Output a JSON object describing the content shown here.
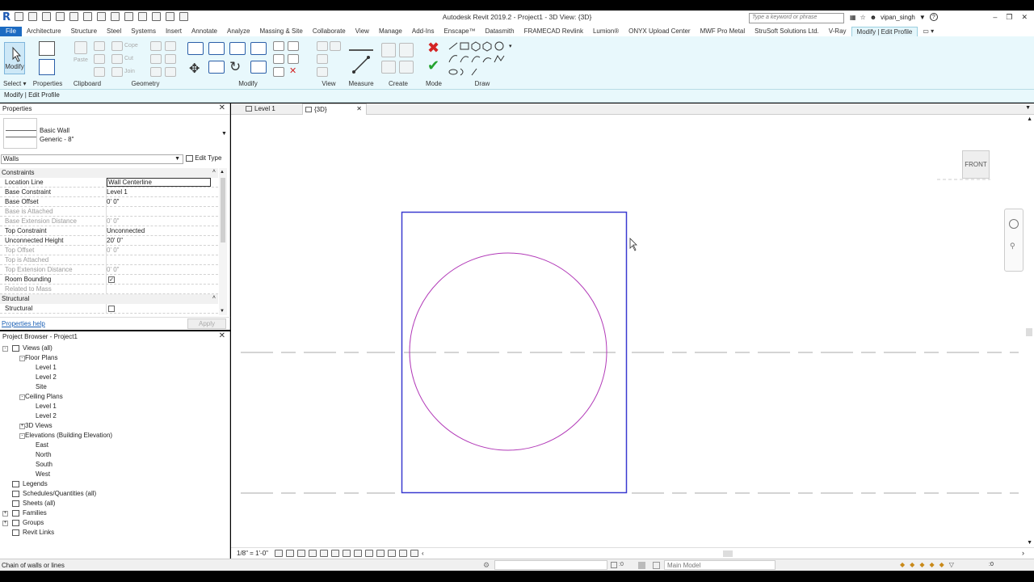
{
  "window": {
    "title": "Autodesk Revit 2019.2 - Project1 - 3D View: {3D}",
    "search_placeholder": "Type a keyword or phrase",
    "user": "vipan_singh"
  },
  "ribbon_tabs": [
    "File",
    "Architecture",
    "Structure",
    "Steel",
    "Systems",
    "Insert",
    "Annotate",
    "Analyze",
    "Massing & Site",
    "Collaborate",
    "View",
    "Manage",
    "Add-Ins",
    "Enscape™",
    "Datasmith",
    "FRAMECAD Revlink",
    "Lumion®",
    "ONYX Upload Center",
    "MWF Pro Metal",
    "StruSoft Solutions Ltd.",
    "V-Ray",
    "Modify | Edit Profile"
  ],
  "ribbon": {
    "modify_label": "Modify",
    "select_label": "Select",
    "properties_label": "Properties",
    "clipboard_label": "Clipboard",
    "geometry_label": "Geometry",
    "modify_panel_label": "Modify",
    "view_label": "View",
    "measure_label": "Measure",
    "create_label": "Create",
    "mode_label": "Mode",
    "draw_label": "Draw",
    "paste_label": "Paste",
    "cope_label": "Cope",
    "cut_label": "Cut",
    "join_label": "Join"
  },
  "options_bar": {
    "context": "Modify | Edit Profile"
  },
  "properties": {
    "title": "Properties",
    "type_family": "Basic Wall",
    "type_name": "Generic - 8\"",
    "filter": "Walls",
    "edit_type": "Edit Type",
    "rows": [
      {
        "key": "Constraints",
        "kind": "group"
      },
      {
        "key": "Location Line",
        "value": "Wall Centerline",
        "kind": "editable"
      },
      {
        "key": "Base Constraint",
        "value": "Level 1",
        "kind": "normal"
      },
      {
        "key": "Base Offset",
        "value": "0'  0\"",
        "kind": "normal"
      },
      {
        "key": "Base is Attached",
        "value": "",
        "kind": "disabled"
      },
      {
        "key": "Base Extension Distance",
        "value": "0'  0\"",
        "kind": "disabled"
      },
      {
        "key": "Top Constraint",
        "value": "Unconnected",
        "kind": "normal"
      },
      {
        "key": "Unconnected Height",
        "value": "20'  0\"",
        "kind": "normal"
      },
      {
        "key": "Top Offset",
        "value": "0'  0\"",
        "kind": "disabled"
      },
      {
        "key": "Top is Attached",
        "value": "",
        "kind": "disabled"
      },
      {
        "key": "Top Extension Distance",
        "value": "0'  0\"",
        "kind": "disabled"
      },
      {
        "key": "Room Bounding",
        "value": "",
        "kind": "checkbox",
        "checked": true
      },
      {
        "key": "Related to Mass",
        "value": "",
        "kind": "disabled"
      },
      {
        "key": "Structural",
        "kind": "group"
      },
      {
        "key": "Structural",
        "value": "",
        "kind": "checkbox",
        "checked": false
      }
    ],
    "help": "Properties help",
    "apply": "Apply"
  },
  "project_browser": {
    "title": "Project Browser - Project1",
    "nodes": [
      {
        "label": "Views (all)",
        "depth": 0,
        "twisty": "-",
        "icon": true
      },
      {
        "label": "Floor Plans",
        "depth": 1,
        "twisty": "-"
      },
      {
        "label": "Level 1",
        "depth": 2
      },
      {
        "label": "Level 2",
        "depth": 2
      },
      {
        "label": "Site",
        "depth": 2
      },
      {
        "label": "Ceiling Plans",
        "depth": 1,
        "twisty": "-"
      },
      {
        "label": "Level 1",
        "depth": 2
      },
      {
        "label": "Level 2",
        "depth": 2
      },
      {
        "label": "3D Views",
        "depth": 1,
        "twisty": "+"
      },
      {
        "label": "Elevations (Building Elevation)",
        "depth": 1,
        "twisty": "-"
      },
      {
        "label": "East",
        "depth": 2
      },
      {
        "label": "North",
        "depth": 2
      },
      {
        "label": "South",
        "depth": 2
      },
      {
        "label": "West",
        "depth": 2
      },
      {
        "label": "Legends",
        "depth": 0,
        "icon": true
      },
      {
        "label": "Schedules/Quantities (all)",
        "depth": 0,
        "icon": true
      },
      {
        "label": "Sheets (all)",
        "depth": 0,
        "icon": true
      },
      {
        "label": "Families",
        "depth": 0,
        "twisty": "+",
        "icon": true
      },
      {
        "label": "Groups",
        "depth": 0,
        "twisty": "+",
        "icon": true
      },
      {
        "label": "Revit Links",
        "depth": 0,
        "icon": true
      }
    ]
  },
  "view_tabs": [
    {
      "label": "Level 1",
      "active": false
    },
    {
      "label": "{3D}",
      "active": true
    }
  ],
  "viewcube": {
    "face": "FRONT"
  },
  "view_control": {
    "scale": "1/8\" = 1'-0\""
  },
  "status": {
    "text": "Chain of walls or lines",
    "coordinate": ":0",
    "model": "Main Model",
    "filter_count": ":0"
  },
  "colors": {
    "accent": "#1c6bc2",
    "boundary": "#3a3ad0",
    "circle": "#b23ab8",
    "ribbon_bg": "#e8f8fc"
  }
}
